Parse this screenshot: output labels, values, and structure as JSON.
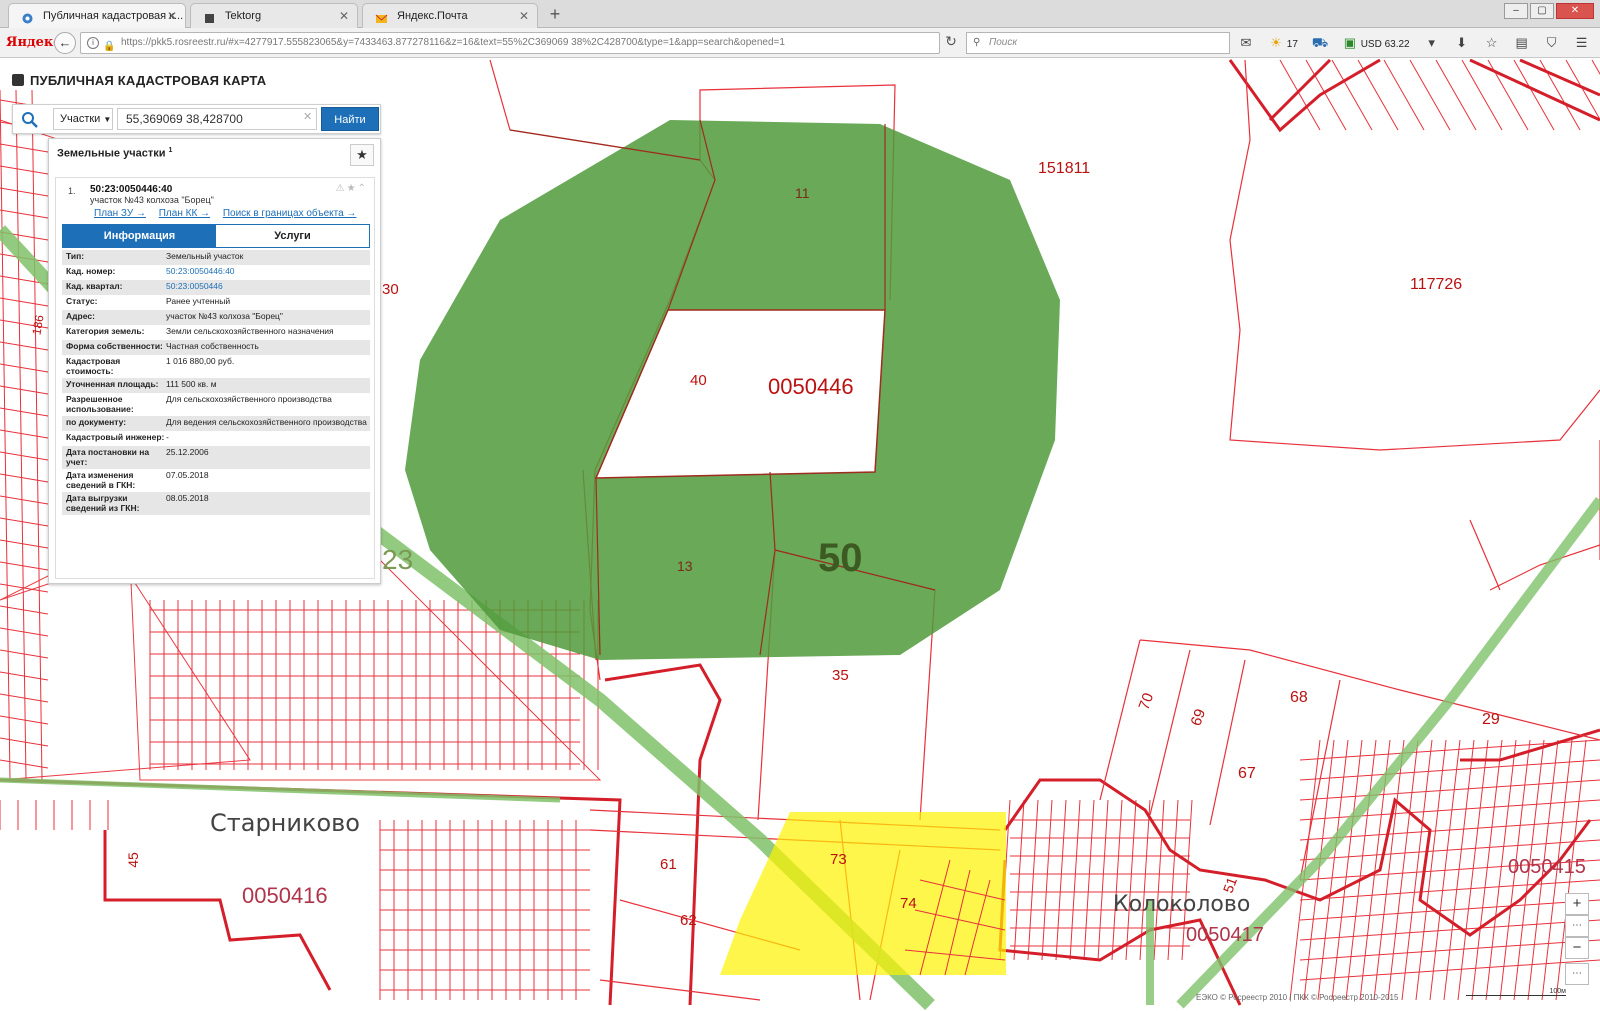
{
  "browser": {
    "tabs": [
      {
        "title": "Публичная кадастровая к...",
        "active": true
      },
      {
        "title": "Tektorg",
        "active": false
      },
      {
        "title": "Яндекс.Почта",
        "active": false
      }
    ],
    "new_tab": "+",
    "logo": "Яндекс",
    "url": "https://pkk5.rosreestr.ru/#x=4277917.555823065&y=7433463.877278116&z=16&text=55%2C369069 38%2C428700&type=1&app=search&opened=1",
    "search_placeholder": "Поиск",
    "weather": "17",
    "currency": "USD 63.22"
  },
  "app": {
    "title": "ПУБЛИЧНАЯ КАДАСТРОВАЯ КАРТА"
  },
  "search": {
    "type": "Участки",
    "query": "55,369069 38,428700",
    "button": "Найти"
  },
  "results": {
    "title": "Земельные участки",
    "count": "1",
    "item": {
      "number": "1.",
      "cad_number": "50:23:0050446:40",
      "description": "участок №43 колхоза \"Борец\"",
      "links": [
        "План ЗУ →",
        "План КК →",
        "Поиск в границах объекта →"
      ],
      "tabs": [
        "Информация",
        "Услуги"
      ],
      "rows": [
        {
          "k": "Тип:",
          "v": "Земельный участок",
          "link": false
        },
        {
          "k": "Кад. номер:",
          "v": "50:23:0050446:40",
          "link": true
        },
        {
          "k": "Кад. квартал:",
          "v": "50:23:0050446",
          "link": true
        },
        {
          "k": "Статус:",
          "v": "Ранее учтенный",
          "link": false
        },
        {
          "k": "Адрес:",
          "v": "участок №43 колхоза \"Борец\"",
          "link": false
        },
        {
          "k": "Категория земель:",
          "v": "Земли сельскохозяйственного назначения",
          "link": false
        },
        {
          "k": "Форма собственности:",
          "v": "Частная собственность",
          "link": false
        },
        {
          "k": "Кадастровая стоимость:",
          "v": "1 016 880,00 руб.",
          "link": false
        },
        {
          "k": "Уточненная площадь:",
          "v": "111 500 кв. м",
          "link": false
        },
        {
          "k": "Разрешенное использование:",
          "v": "Для сельскохозяйственного производства",
          "link": false
        },
        {
          "k": "по документу:",
          "v": "Для ведения сельскохозяйственного производства",
          "link": false
        },
        {
          "k": "Кадастровый инженер:",
          "v": "-",
          "link": false
        },
        {
          "k": "Дата постановки на учет:",
          "v": "25.12.2006",
          "link": false
        },
        {
          "k": "Дата изменения сведений в ГКН:",
          "v": "07.05.2018",
          "link": false
        },
        {
          "k": "Дата выгрузки сведений из ГКН:",
          "v": "08.05.2018",
          "link": false
        }
      ]
    }
  },
  "map": {
    "labels": {
      "p151811": "151811",
      "p117726": "117726",
      "p11": "11",
      "p40": "40",
      "q0050446": "0050446",
      "p13": "13",
      "d50": "50",
      "p35": "35",
      "p30": "30",
      "p23": "23",
      "p70": "70",
      "p69": "69",
      "p68": "68",
      "p67": "67",
      "p29": "29",
      "p61": "61",
      "p62": "62",
      "p73": "73",
      "p74": "74",
      "p45": "45",
      "p51": "51",
      "p186": "186",
      "starnikovo": "Старниково",
      "kolokolovo": "Колоколово",
      "q0050416": "0050416",
      "q0050417": "0050417",
      "q0050415": "0050415"
    },
    "copyright": "ЕЭКО © Росреестр 2010 | ПКК © Росреестр 2010-2015",
    "scale": "100м",
    "colors": {
      "boundary": "#e8313b",
      "selected_area": "#4f9a3a",
      "highlight": "#fff200",
      "road": "#7fc26a"
    }
  }
}
